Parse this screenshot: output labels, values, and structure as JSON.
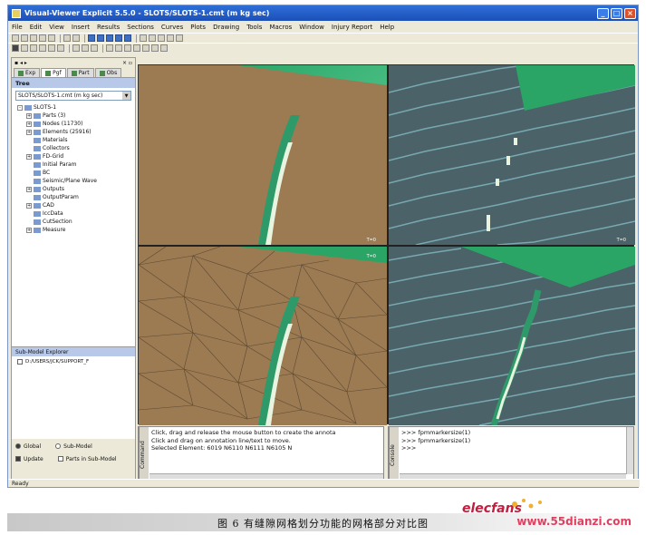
{
  "window": {
    "title": "Visual-Viewer Explicit 5.5.0 - SLOTS/SLOTS-1.cmt (m kg sec)",
    "controls": [
      "_",
      "□",
      "×"
    ]
  },
  "menu": [
    "File",
    "Edit",
    "View",
    "Insert",
    "Results",
    "Sections",
    "Curves",
    "Plots",
    "Drawing",
    "Tools",
    "Macros",
    "Window",
    "Injury Report",
    "Help"
  ],
  "left_panel": {
    "tabs": [
      "Exp",
      "Pgf",
      "Part",
      "Obs"
    ],
    "tree_title": "Tree",
    "model_selector": "SLOTS/SLOTS-1.cmt (m kg sec)",
    "tree_items": [
      {
        "label": "SLOTS-1",
        "level": 0,
        "expand": "-"
      },
      {
        "label": "Parts (3)",
        "level": 1,
        "expand": "+"
      },
      {
        "label": "Nodes (11730)",
        "level": 1,
        "expand": "+"
      },
      {
        "label": "Elements (25916)",
        "level": 1,
        "expand": "+"
      },
      {
        "label": "Materials",
        "level": 1,
        "expand": ""
      },
      {
        "label": "Collectors",
        "level": 1,
        "expand": ""
      },
      {
        "label": "FD-Grid",
        "level": 1,
        "expand": "+"
      },
      {
        "label": "Initial Param",
        "level": 1,
        "expand": ""
      },
      {
        "label": "BC",
        "level": 1,
        "expand": ""
      },
      {
        "label": "Seismic/Plane Wave",
        "level": 1,
        "expand": ""
      },
      {
        "label": "Outputs",
        "level": 1,
        "expand": "+"
      },
      {
        "label": "OutputParam",
        "level": 1,
        "expand": ""
      },
      {
        "label": "CAD",
        "level": 1,
        "expand": "+"
      },
      {
        "label": "IccData",
        "level": 1,
        "expand": ""
      },
      {
        "label": "CutSection",
        "level": 1,
        "expand": ""
      },
      {
        "label": "Measure",
        "level": 1,
        "expand": "+"
      }
    ],
    "submodel_title": "Sub-Model Explorer",
    "submodel_item": "D:/USERS/JCK/SUPPORT_F",
    "options": {
      "global": "Global",
      "submodel": "Sub-Model",
      "update": "Update",
      "parts_in_submodel": "Parts in Sub-Model"
    }
  },
  "command": {
    "label": "Command",
    "lines": [
      "Click, drag and release the mouse button to create the annota",
      "Click and drag on annotation line/text to move.",
      "Selected Element: 6019      N6110      N6111      N6105      N"
    ]
  },
  "console": {
    "label": "Console",
    "lines": [
      ">>> fpmmarkersize(1)",
      ">>> fpmmarkersize(1)",
      ">>>"
    ]
  },
  "status": "Ready",
  "caption": "图 6   有缝隙网格划分功能的网格部分对比图",
  "watermark": {
    "logo": "elecfans",
    "url": "www.55dianzi.com"
  },
  "colors": {
    "titlebar": "#1c4fb8",
    "model_brown": "#9c7a52",
    "background_green": "#2aa565",
    "mesh_slate": "#4a6268",
    "slot_white": "#e8f4e0"
  }
}
